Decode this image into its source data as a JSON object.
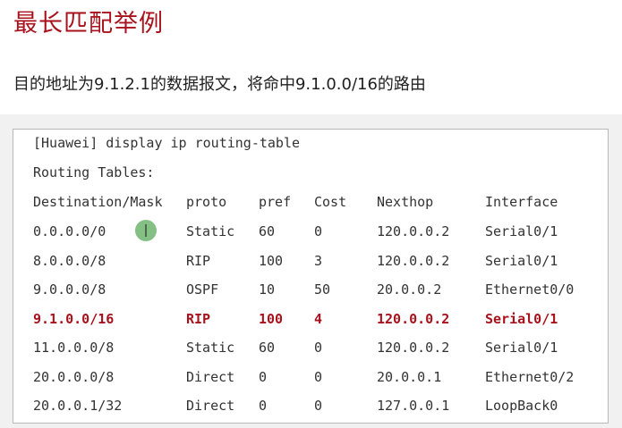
{
  "title": "最长匹配举例",
  "subtitle": "目的地址为9.1.2.1的数据报文，将命中9.1.0.0/16的路由",
  "terminal": {
    "command": "[Huawei] display ip routing-table",
    "section": "Routing Tables:",
    "headers": [
      "Destination/Mask",
      "proto",
      "pref",
      "Cost",
      "Nexthop",
      "Interface"
    ],
    "rows": [
      [
        "0.0.0.0/0",
        "Static",
        "60",
        "0",
        "120.0.0.2",
        "Serial0/1"
      ],
      [
        "8.0.0.0/8",
        "RIP",
        "100",
        "3",
        "120.0.0.2",
        "Serial0/1"
      ],
      [
        "9.0.0.0/8",
        "OSPF",
        "10",
        "50",
        "20.0.0.2",
        "Ethernet0/0"
      ],
      [
        "9.1.0.0/16",
        "RIP",
        "100",
        "4",
        "120.0.0.2",
        "Serial0/1"
      ],
      [
        "11.0.0.0/8",
        "Static",
        "60",
        "0",
        "120.0.0.2",
        "Serial0/1"
      ],
      [
        "20.0.0.0/8",
        "Direct",
        "0",
        "0",
        "20.0.0.1",
        "Ethernet0/2"
      ],
      [
        "20.0.0.1/32",
        "Direct",
        "0",
        "0",
        "127.0.0.1",
        "LoopBack0"
      ]
    ],
    "highlighted_row": 3
  },
  "colors": {
    "accent": "#a8121c",
    "text": "#333333",
    "cursor": "#6fb56f"
  },
  "cursor_icon": "text-cursor-icon"
}
